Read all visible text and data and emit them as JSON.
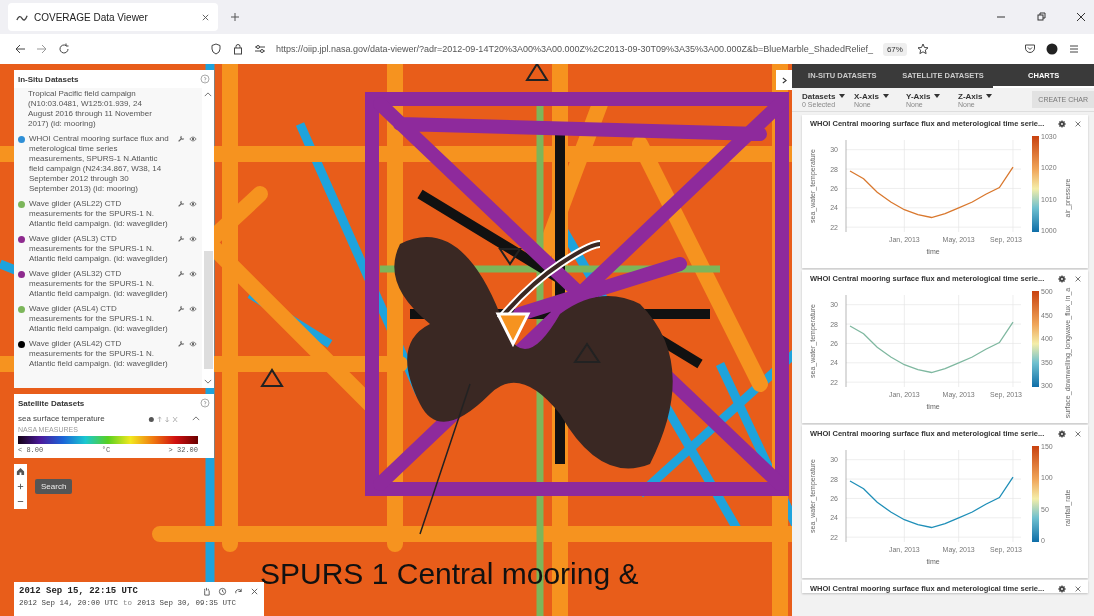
{
  "browser": {
    "tab_title": "COVERAGE Data Viewer",
    "url": "https://oiip.jpl.nasa.gov/data-viewer/?adr=2012-09-14T20%3A00%3A00.000Z%2C2013-09-30T09%3A35%3A00.000Z&b=BlueMarble_ShadedRelief_",
    "zoom": "67%"
  },
  "map": {
    "overlay_text": "SPURS 1 Central mooring &"
  },
  "in_situ": {
    "title": "In-Situ Datasets",
    "items": [
      {
        "text": "Tropical Pacific field campaign (N10:03.0481, W125:01.939, 24 August 2016 through 11 November 2017) (id: mooring)"
      },
      {
        "color": "#2e8fd6",
        "text": "WHOI Central mooring surface flux and meterological time series measurements, SPURS-1 N.Atlantic field campaign (N24:34.867, W38, 14 September 2012 through 30 September 2013) (id: mooring)"
      },
      {
        "color": "#7cb65a",
        "text": "Wave glider (ASL22) CTD measurements for the SPURS-1 N. Atlantic field campaign. (id: waveglider)"
      },
      {
        "color": "#8e2a8e",
        "text": "Wave glider (ASL3) CTD measurements for the SPURS-1 N. Atlantic field campaign. (id: waveglider)"
      },
      {
        "color": "#8e2a8e",
        "text": "Wave glider (ASL32) CTD measurements for the SPURS-1 N. Atlantic field campaign. (id: waveglider)"
      },
      {
        "color": "#7cb65a",
        "text": "Wave glider (ASL4) CTD measurements for the SPURS-1 N. Atlantic field campaign. (id: waveglider)"
      },
      {
        "color": "#000000",
        "text": "Wave glider (ASL42) CTD measurements for the SPURS-1 N. Atlantic field campaign. (id: waveglider)"
      }
    ]
  },
  "satellite": {
    "title": "Satellite Datasets",
    "layer": "sea surface temperature",
    "source": "NASA MEASURES",
    "min": "< 8.00",
    "unit": "°C",
    "max": "> 32.00"
  },
  "map_controls": {
    "search": "Search"
  },
  "time": {
    "current": "2012 Sep 15, 22:15 UTC",
    "start": "2012 Sep 14, 20:00 UTC",
    "to": "to",
    "end": "2013 Sep 30, 09:35 UTC"
  },
  "right_panel": {
    "tabs": [
      {
        "label": "IN-SITU DATASETS",
        "selected": false
      },
      {
        "label": "SATELLITE DATASETS",
        "selected": false
      },
      {
        "label": "CHARTS",
        "selected": true
      }
    ],
    "selectors": [
      {
        "label": "Datasets",
        "value": "0 Selected"
      },
      {
        "label": "X-Axis",
        "value": "None"
      },
      {
        "label": "Y-Axis",
        "value": "None"
      },
      {
        "label": "Z-Axis",
        "value": "None"
      }
    ],
    "create_button": "CREATE CHAR",
    "charts": [
      {
        "title": "WHOI Central mooring surface flux and meterological time serie...",
        "colorbar_label": "air_pressure",
        "colorbar_ticks": [
          "1030",
          "1020",
          "1010",
          "1000"
        ],
        "chart_data": {
          "type": "line",
          "xlabel": "time",
          "ylabel": "sea_water_temperature",
          "categories": [
            null,
            null,
            null,
            null,
            "Jan, 2013",
            null,
            null,
            null,
            "May, 2013",
            null,
            null,
            null,
            "Sep, 2013"
          ],
          "ylim": [
            21.5,
            31
          ],
          "yticks": [
            22,
            24,
            26,
            28,
            30
          ],
          "grid": true,
          "series": [
            {
              "color": "#d9782e",
              "values": [
                27.8,
                27,
                25.6,
                24.6,
                23.8,
                23.3,
                23,
                23.4,
                24,
                24.6,
                25.4,
                26.1,
                28.2
              ]
            }
          ]
        }
      },
      {
        "title": "WHOI Central mooring surface flux and meterological time serie...",
        "colorbar_label": "surface_downwelling_longwave_flux_in_a",
        "colorbar_ticks": [
          "500",
          "450",
          "400",
          "350",
          "300"
        ],
        "chart_data": {
          "type": "line",
          "xlabel": "time",
          "ylabel": "sea_water_temperature",
          "categories": [
            null,
            null,
            null,
            null,
            "Jan, 2013",
            null,
            null,
            null,
            "May, 2013",
            null,
            null,
            null,
            "Sep, 2013"
          ],
          "ylim": [
            21.5,
            31
          ],
          "yticks": [
            22,
            24,
            26,
            28,
            30
          ],
          "grid": true,
          "series": [
            {
              "color": "#7fb8a0",
              "values": [
                27.8,
                27,
                25.6,
                24.6,
                23.8,
                23.3,
                23,
                23.4,
                24,
                24.6,
                25.4,
                26.1,
                28.2
              ]
            }
          ]
        }
      },
      {
        "title": "WHOI Central mooring surface flux and meterological time serie...",
        "colorbar_label": "rainfall_rate",
        "colorbar_ticks": [
          "150",
          "100",
          "50",
          "0"
        ],
        "chart_data": {
          "type": "line",
          "xlabel": "time",
          "ylabel": "sea_water_temperature",
          "categories": [
            null,
            null,
            null,
            null,
            "Jan, 2013",
            null,
            null,
            null,
            "May, 2013",
            null,
            null,
            null,
            "Sep, 2013"
          ],
          "ylim": [
            21.5,
            31
          ],
          "yticks": [
            22,
            24,
            26,
            28,
            30
          ],
          "grid": true,
          "series": [
            {
              "color": "#1f8fb8",
              "values": [
                27.8,
                27,
                25.6,
                24.6,
                23.8,
                23.3,
                23,
                23.4,
                24,
                24.6,
                25.4,
                26.1,
                28.2
              ]
            }
          ]
        }
      },
      {
        "title": "WHOI Central mooring surface flux and meterological time serie..."
      }
    ]
  }
}
